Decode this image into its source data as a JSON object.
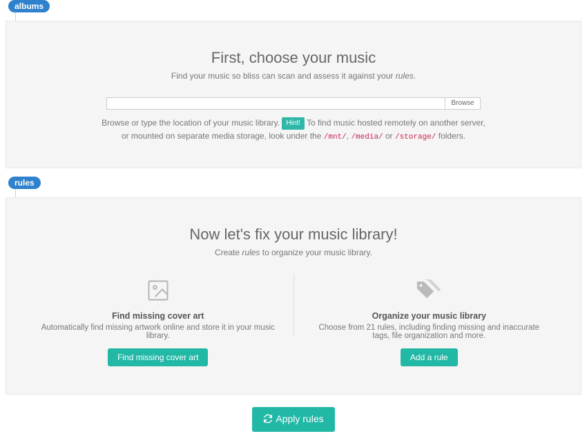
{
  "sections": {
    "albums": {
      "tag": "albums"
    },
    "rules": {
      "tag": "rules"
    }
  },
  "albums_panel": {
    "heading": "First, choose your music",
    "subtitle_pre": "Find your music so bliss can scan and assess it against your ",
    "subtitle_em": "rules",
    "subtitle_post": ".",
    "browse_label": "Browse",
    "help_pre": "Browse or type the location of your music library. ",
    "hint_label": "Hint!",
    "help_mid": " To find music hosted remotely on another server, or mounted on separate media storage, look under the ",
    "path1": "/mnt/",
    "sep1": ", ",
    "path2": "/media/",
    "or": " or ",
    "path3": "/storage/",
    "help_post": " folders."
  },
  "rules_panel": {
    "heading": "Now let's fix your music library!",
    "subtitle_pre": "Create ",
    "subtitle_em": "rules",
    "subtitle_post": " to organize your music library.",
    "left": {
      "title": "Find missing cover art",
      "desc": "Automatically find missing artwork online and store it in your music library.",
      "button": "Find missing cover art"
    },
    "right": {
      "title": "Organize your music library",
      "desc": "Choose from 21 rules, including finding missing and inaccurate tags, file organization and more.",
      "button": "Add a rule"
    }
  },
  "footer": {
    "apply_label": "Apply rules"
  }
}
